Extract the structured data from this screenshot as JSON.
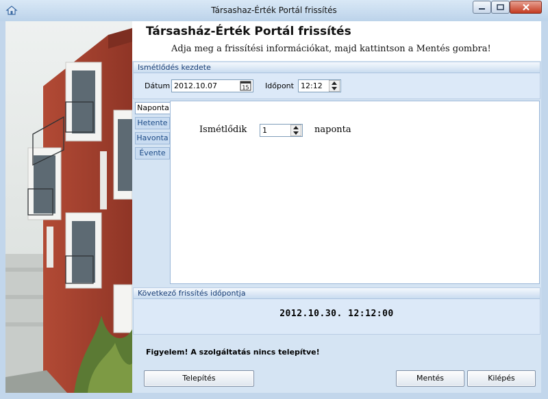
{
  "window": {
    "title": "Társashaz-Érték Portál frissítés"
  },
  "header": {
    "title": "Társasház-Érték Portál frissítés",
    "subtitle": "Adja meg a frissítési információkat, majd kattintson a Mentés gombra!"
  },
  "start_group": {
    "title": "Ismétlődés kezdete",
    "date_label": "Dátum",
    "date_value": "2012.10.07",
    "calendar_icon_text": "15",
    "time_label": "Időpont",
    "time_value": "12:12"
  },
  "tabs": [
    {
      "label": "Naponta",
      "active": true
    },
    {
      "label": "Hetente",
      "active": false
    },
    {
      "label": "Havonta",
      "active": false
    },
    {
      "label": "Évente",
      "active": false
    }
  ],
  "daily": {
    "repeat_label": "Ismétlődik",
    "repeat_value": "1",
    "repeat_unit": "naponta"
  },
  "next_group": {
    "title": "Következő frissítés időpontja",
    "value": "2012.10.30. 12:12:00"
  },
  "warning": "Figyelem! A szolgáltatás nincs telepítve!",
  "buttons": {
    "install": "Telepítés",
    "save": "Mentés",
    "exit": "Kilépés"
  },
  "colors": {
    "accent": "#163c74",
    "building": "#a8432f"
  }
}
